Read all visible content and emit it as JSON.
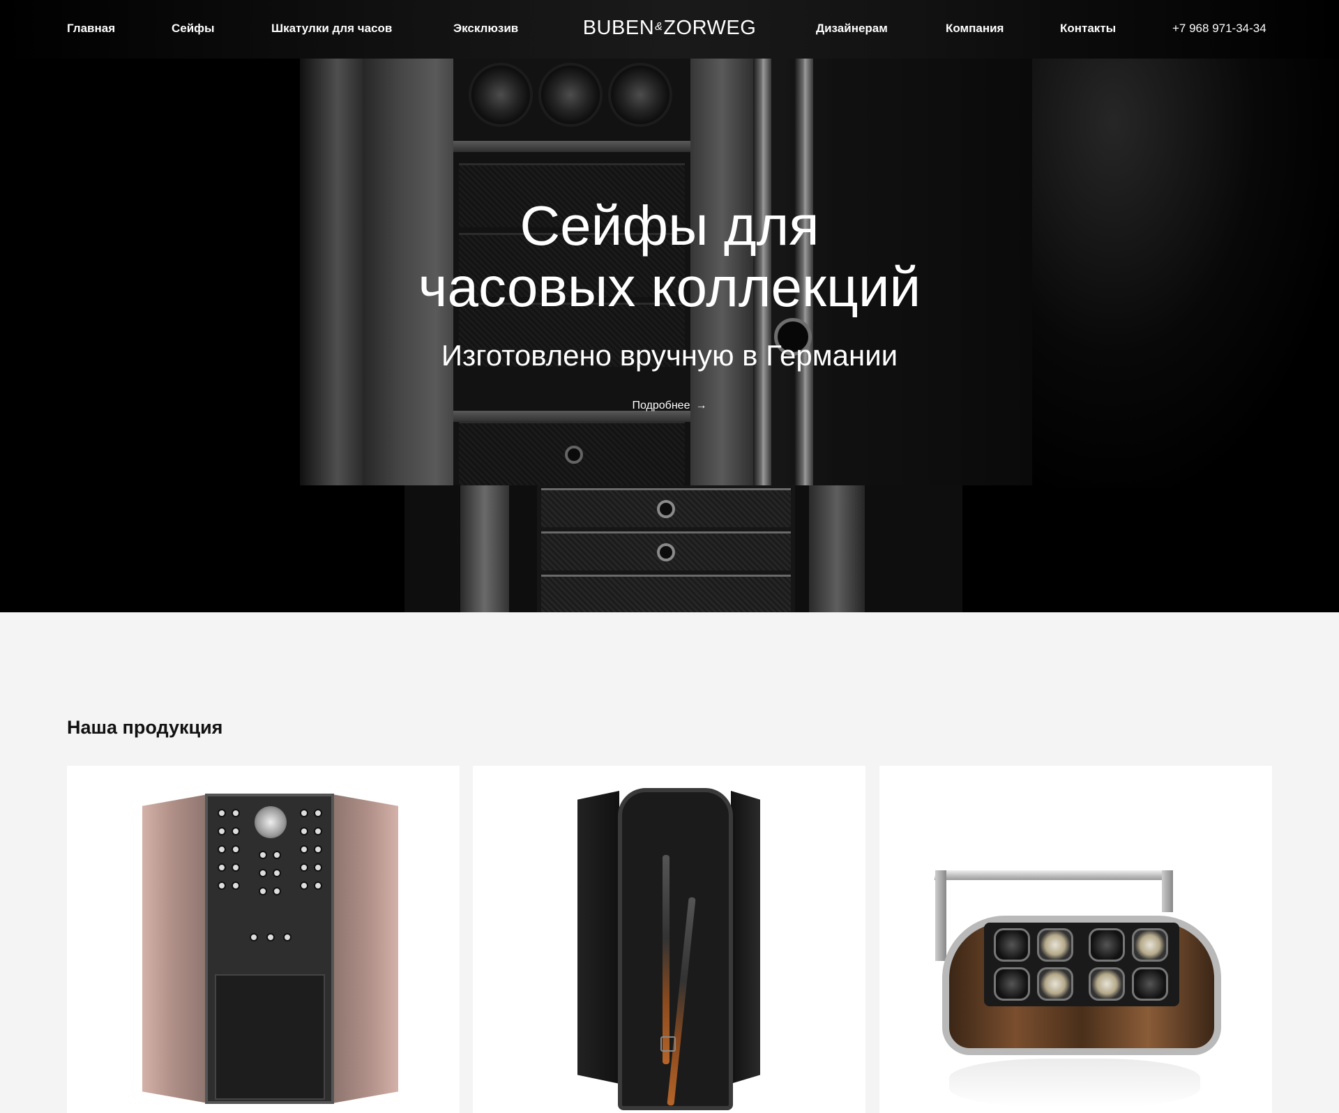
{
  "nav": {
    "left": [
      "Главная",
      "Сейфы",
      "Шкатулки для часов",
      "Эксклюзив"
    ],
    "logo": {
      "left": "BUBEN",
      "amp": "&",
      "right": "ZORWEG"
    },
    "right": [
      "Дизайнерам",
      "Компания",
      "Контакты"
    ],
    "phone": "+7 968 971-34-34"
  },
  "hero": {
    "title_line1": "Сейфы для",
    "title_line2": "часовых коллекций",
    "subtitle": "Изготовлено вручную в Германии",
    "more_label": "Подробнее",
    "arrow_icon": "→"
  },
  "products": {
    "title": "Наша продукция"
  }
}
